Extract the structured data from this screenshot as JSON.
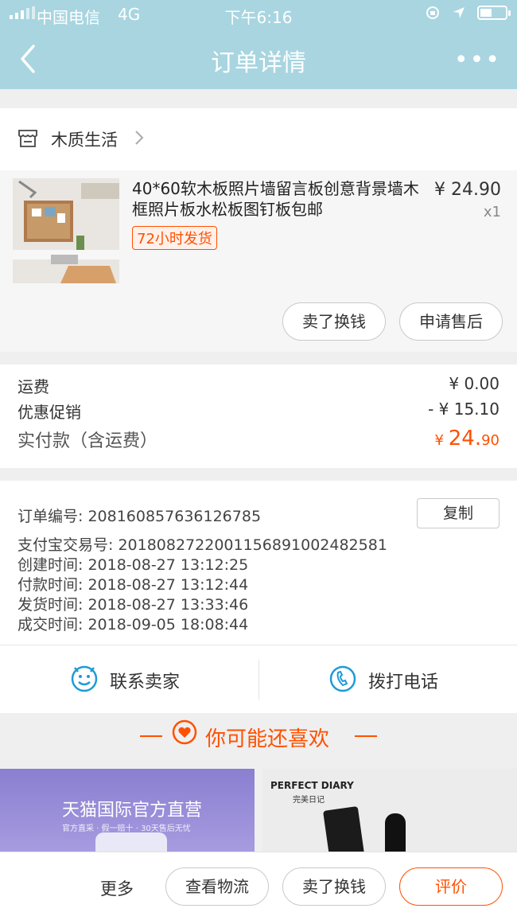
{
  "status_bar": {
    "carrier": "中国电信",
    "network": "4G",
    "time": "下午6:16"
  },
  "nav": {
    "title": "订单详情",
    "more": "•••"
  },
  "shop": {
    "name": "木质生活"
  },
  "product": {
    "title": "40*60软木板照片墙留言板创意背景墙木框照片板水松板图钉板包邮",
    "badge": "72小时发货",
    "price": "¥ 24.90",
    "quantity": "x1",
    "buttons": [
      "卖了换钱",
      "申请售后"
    ]
  },
  "fees": {
    "shipping_label": "运费",
    "shipping_value": "¥ 0.00",
    "discount_label": "优惠促销",
    "discount_value": "- ¥ 15.10",
    "total_label": "实付款（含运费）",
    "total_currency": "¥ ",
    "total_int": "24.",
    "total_dec": "90"
  },
  "order_info": {
    "order_no": "订单编号:  208160857636126785",
    "copy_label": "复制",
    "alipay_no": "支付宝交易号:  2018082722001156891002482581",
    "created": "创建时间:  2018-08-27 13:12:25",
    "paid": "付款时间:  2018-08-27 13:12:44",
    "shipped": "发货时间:  2018-08-27 13:33:46",
    "completed": "成交时间:  2018-09-05 18:08:44"
  },
  "contact": {
    "seller": "联系卖家",
    "call": "拨打电话"
  },
  "recommend": {
    "title": "你可能还喜欢",
    "banner_left_title": "天猫国际官方直营",
    "banner_left_sub": "官方直采 · 假一赔十 · 30天售后无忧",
    "banner_right_brand": "PERFECT DIARY",
    "banner_right_sub": "完美日记"
  },
  "bottom_bar": {
    "more": "更多",
    "logistics": "查看物流",
    "resell": "卖了换钱",
    "review": "评价"
  },
  "colors": {
    "nav_bg": "#a8d5e0",
    "accent": "#ff5000",
    "contact_icon": "#1e9bd7"
  }
}
